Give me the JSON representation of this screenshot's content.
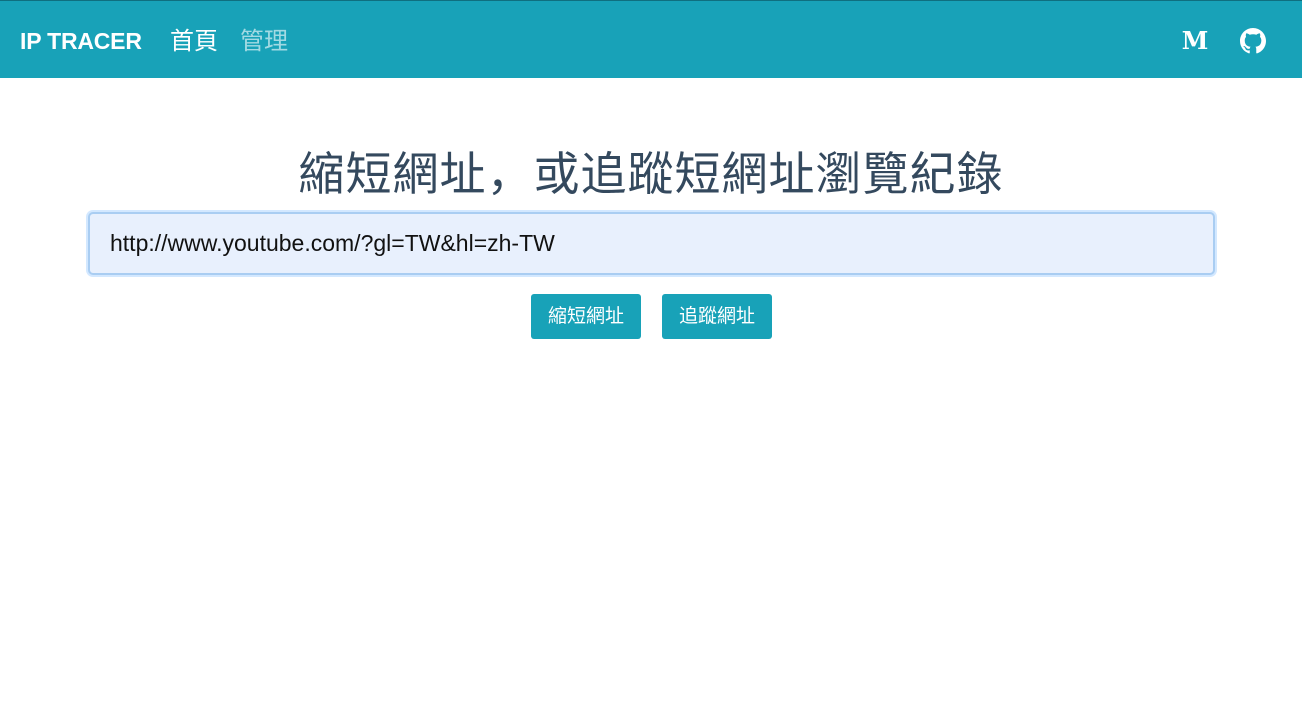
{
  "navbar": {
    "brand": "IP TRACER",
    "links": [
      {
        "label": "首頁",
        "active": true
      },
      {
        "label": "管理",
        "active": false
      }
    ],
    "icons": [
      "medium-icon",
      "github-icon"
    ],
    "medium_glyph": "M",
    "bg_color": "#18a2b8"
  },
  "main": {
    "heading": "縮短網址，或追蹤短網址瀏覽紀錄",
    "url_input": {
      "value": "http://www.youtube.com/?gl=TW&hl=zh-TW"
    },
    "buttons": {
      "shorten_label": "縮短網址",
      "trace_label": "追蹤網址"
    }
  }
}
